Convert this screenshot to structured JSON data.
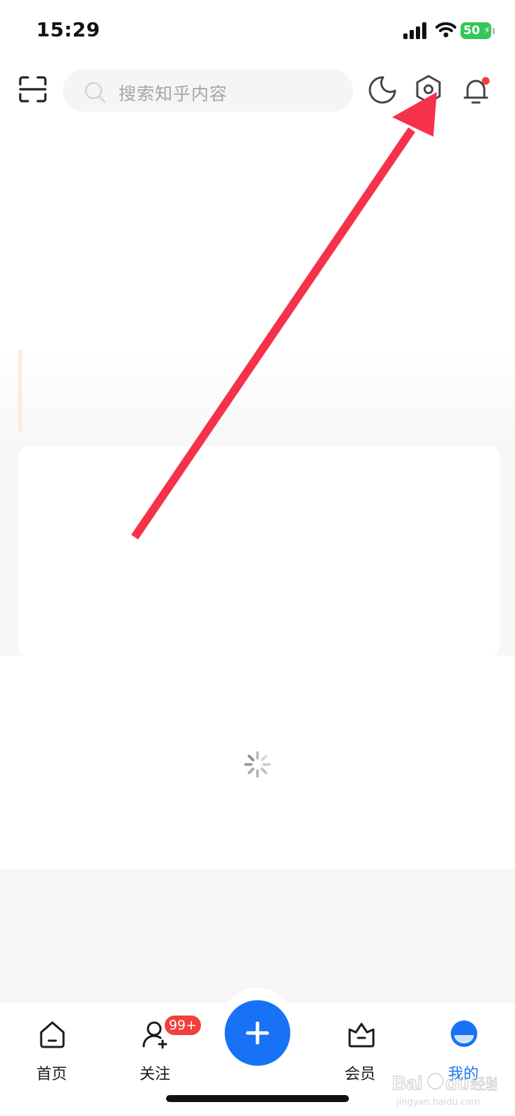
{
  "status_bar": {
    "time": "15:29",
    "battery": "50"
  },
  "top_bar": {
    "search_placeholder": "搜索知乎内容"
  },
  "tab_bar": {
    "home_label": "首页",
    "follow_label": "关注",
    "follow_badge": "99+",
    "vip_label": "会员",
    "me_label": "我的"
  },
  "watermark": {
    "brand": "Baidu经验",
    "url": "jingyan.baidu.com"
  },
  "colors": {
    "accent": "#1772f6",
    "badge": "#f1403c",
    "annotation_arrow": "#f5324a",
    "battery": "#34c759"
  },
  "icons": {
    "scan": "scan-icon",
    "search": "search-icon",
    "night_mode": "moon-icon",
    "settings": "settings-icon",
    "notifications": "bell-icon",
    "home": "home-icon",
    "follow": "follow-icon",
    "publish": "plus-icon",
    "vip": "crown-icon",
    "me": "avatar-icon"
  }
}
